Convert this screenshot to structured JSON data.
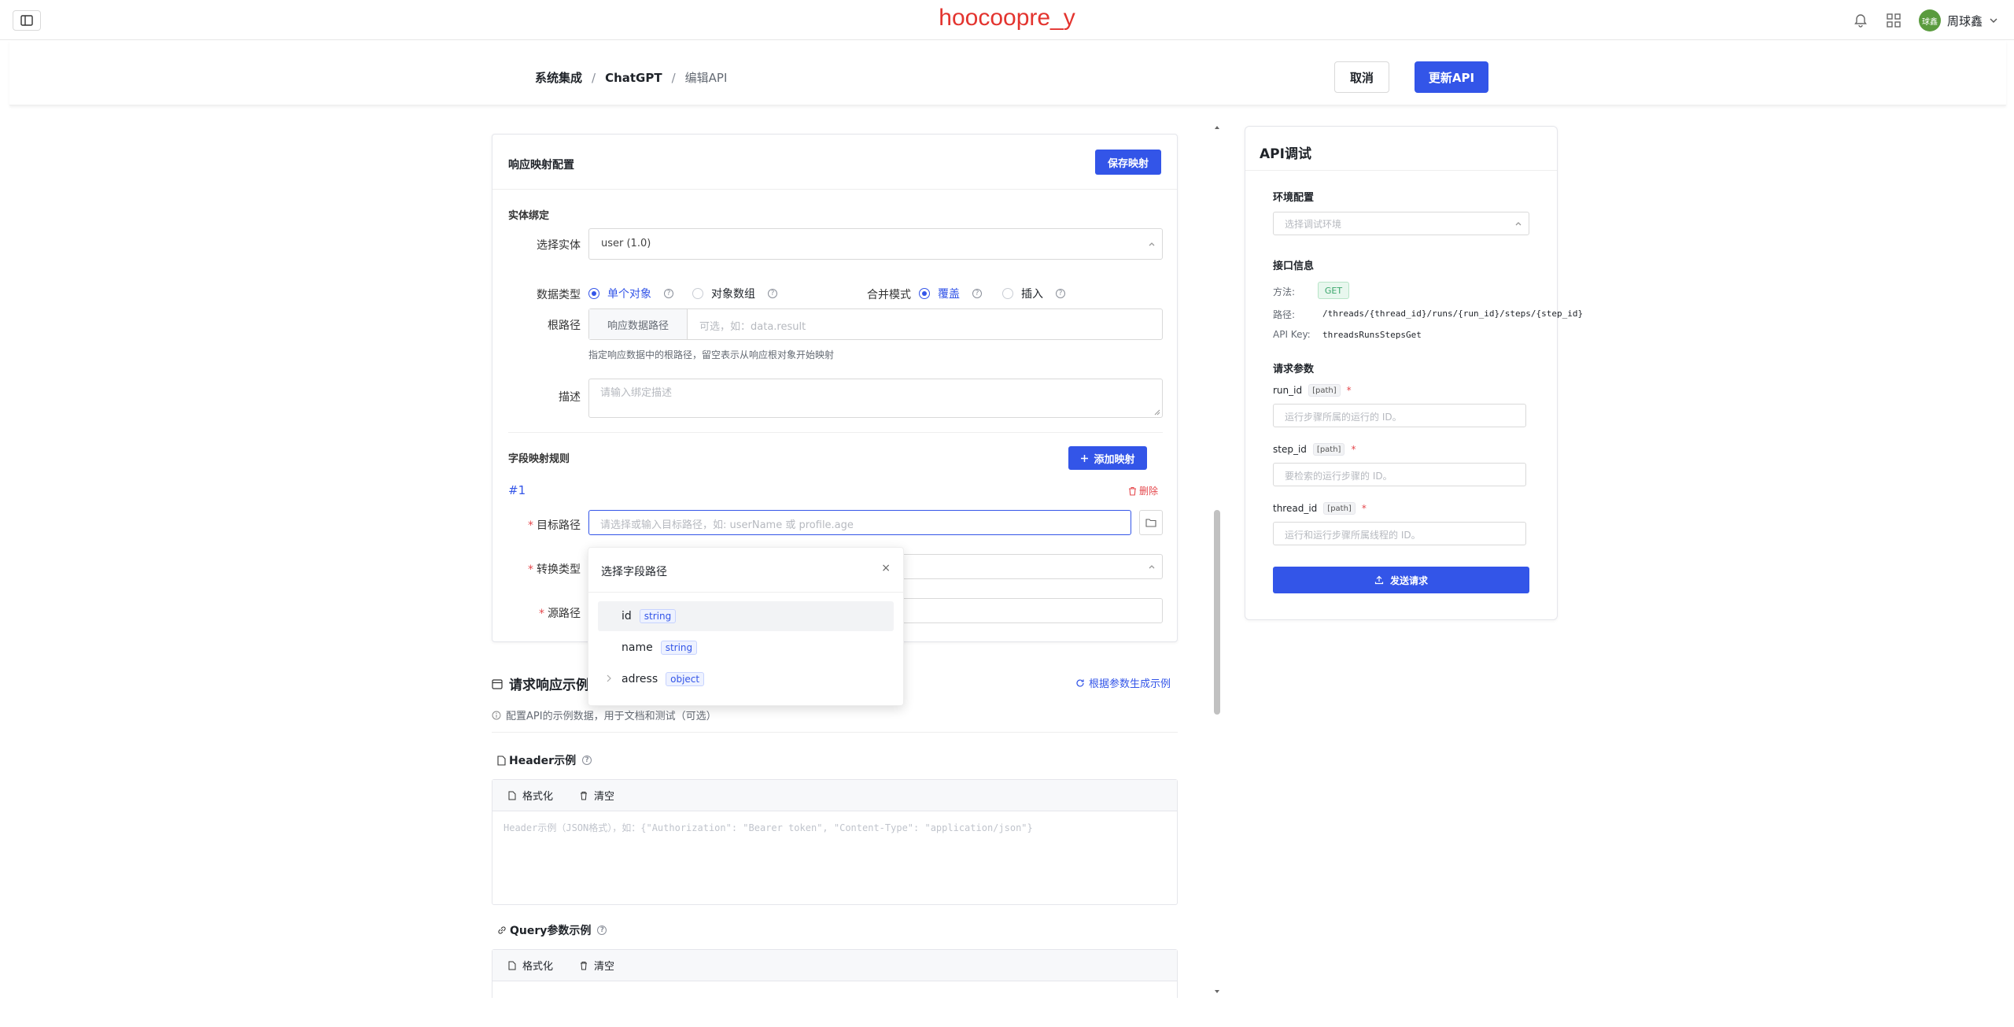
{
  "brand": "hoocoopre_y",
  "user": {
    "avatar_text": "球鑫",
    "name": "周球鑫"
  },
  "breadcrumb": {
    "item1": "系统集成",
    "item2": "ChatGPT",
    "current": "编辑API",
    "separator": "/"
  },
  "actions": {
    "cancel": "取消",
    "update": "更新API"
  },
  "mapping_card": {
    "title": "响应映射配置",
    "save_button": "保存映射",
    "entity_section": "实体绑定",
    "select_entity_label": "选择实体",
    "select_entity_value": "user (1.0)",
    "data_type_label": "数据类型",
    "data_type_single": "单个对象",
    "data_type_array": "对象数组",
    "merge_mode_label": "合并模式",
    "merge_overwrite": "覆盖",
    "merge_insert": "插入",
    "root_path_label": "根路径",
    "root_path_addon": "响应数据路径",
    "root_path_placeholder": "可选，如：data.result",
    "root_path_hint": "指定响应数据中的根路径，留空表示从响应根对象开始映射",
    "description_label": "描述",
    "description_placeholder": "请输入绑定描述",
    "field_rules_label": "字段映射规则",
    "add_mapping_button": "添加映射",
    "rule_index": "#1",
    "delete_label": "删除",
    "target_path_label": "目标路径",
    "target_path_placeholder": "请选择或输入目标路径，如: userName 或 profile.age",
    "convert_type_label": "转换类型",
    "source_path_label": "源路径"
  },
  "field_popover": {
    "title": "选择字段路径",
    "close": "×",
    "items": [
      {
        "name": "id",
        "type": "string"
      },
      {
        "name": "name",
        "type": "string"
      },
      {
        "name": "adress",
        "type": "object"
      }
    ]
  },
  "example_section": {
    "title": "请求响应示例",
    "generate_link": "根据参数生成示例",
    "hint": "配置API的示例数据，用于文档和测试（可选）",
    "header_title": "Header示例",
    "format_button": "格式化",
    "clear_button": "清空",
    "header_placeholder": "Header示例（JSON格式），如：{\"Authorization\": \"Bearer token\", \"Content-Type\": \"application/json\"}",
    "query_title": "Query参数示例"
  },
  "debug_panel": {
    "title": "API调试",
    "env_section": "环境配置",
    "env_placeholder": "选择调试环境",
    "info_section": "接口信息",
    "method_label": "方法:",
    "method_value": "GET",
    "path_label": "路径:",
    "path_value": "/threads/{thread_id}/runs/{run_id}/steps/{step_id}",
    "apikey_label": "API Key:",
    "apikey_value": "threadsRunsStepsGet",
    "params_section": "请求参数",
    "params": [
      {
        "name": "run_id",
        "in": "[path]",
        "required": "*",
        "placeholder": "运行步骤所属的运行的 ID。"
      },
      {
        "name": "step_id",
        "in": "[path]",
        "required": "*",
        "placeholder": "要检索的运行步骤的 ID。"
      },
      {
        "name": "thread_id",
        "in": "[path]",
        "required": "*",
        "placeholder": "运行和运行步骤所属线程的 ID。"
      }
    ],
    "send_button": "发送请求"
  },
  "colors": {
    "primary": "#3355e8",
    "brand_red": "#e3342f",
    "required": "#e5484d",
    "get_green": "#3aa66b"
  }
}
